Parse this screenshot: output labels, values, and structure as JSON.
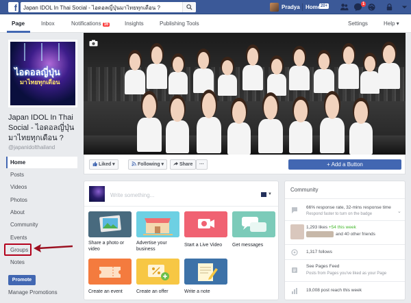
{
  "topbar": {
    "search_value": "Japan IDOL In Thai Social - ไอดอลญี่ปุ่นมาไทยทุกเดือน ?",
    "user_name": "Pradya",
    "home_label": "Home",
    "home_count": "20+",
    "notification_count": "1"
  },
  "tabs": {
    "page": "Page",
    "inbox": "Inbox",
    "notifications": "Notifications",
    "notifications_count": "16",
    "insights": "Insights",
    "publishing_tools": "Publishing Tools",
    "settings": "Settings",
    "help": "Help ▾"
  },
  "profile": {
    "pic_line1": "ไอดอลญี่ปุ่น",
    "pic_line2": "มาไทยทุกเดือน",
    "name": "Japan IDOL In Thai Social - ไอดอลญี่ปุ่นมาไทยทุกเดือน ?",
    "handle": "@japanidolthailand"
  },
  "nav": {
    "home": "Home",
    "posts": "Posts",
    "videos": "Videos",
    "photos": "Photos",
    "about": "About",
    "community": "Community",
    "events": "Events",
    "groups": "Groups",
    "notes": "Notes",
    "promote": "Promote",
    "manage_promotions": "Manage Promotions"
  },
  "actions": {
    "liked": "Liked ▾",
    "following": "Following ▾",
    "share": "Share",
    "more": "···",
    "add_button": "+ Add a Button"
  },
  "composer": {
    "placeholder": "Write something...",
    "tiles": [
      {
        "label": "Share a photo or video"
      },
      {
        "label": "Advertise your business"
      },
      {
        "label": "Start a Live Video"
      },
      {
        "label": "Get messages"
      },
      {
        "label": "Create an event"
      },
      {
        "label": "Create an offer"
      },
      {
        "label": "Write a note"
      }
    ]
  },
  "community": {
    "title": "Community",
    "response_rate": "66% response rate, 32-mins response time",
    "response_sub": "Respond faster to turn on the badge",
    "likes": "1,293 likes",
    "likes_week": "+54 this week",
    "friends_like": "and 40 other friends",
    "follows": "1,317 follows",
    "feed_title": "See Pages Feed",
    "feed_sub": "Posts from Pages you've liked as your Page",
    "reach": "19,008 post reach this week"
  },
  "colors": {
    "facebook_blue": "#3b5998",
    "button_blue": "#4267b2",
    "highlight_red": "#b3001b"
  }
}
